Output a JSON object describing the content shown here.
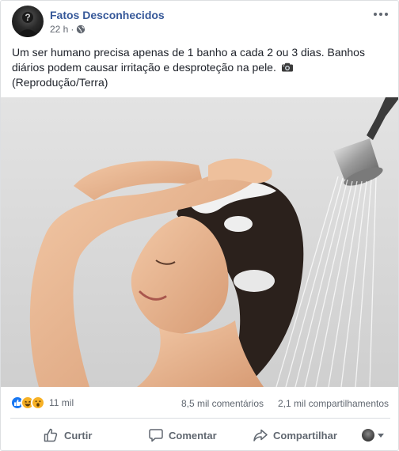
{
  "post": {
    "author": "Fatos Desconhecidos",
    "time": "22 h",
    "separator": "·",
    "text": "Um ser humano precisa apenas de 1 banho a cada 2 ou 3 dias. Banhos diários podem causar irritação e desproteção na pele.",
    "credit": "(Reprodução/Terra)",
    "photo_icon": "shower-woman-photo"
  },
  "stats": {
    "reaction_icons": [
      "like-icon",
      "haha-icon",
      "wow-icon"
    ],
    "reactions_count": "11 mil",
    "comments": "8,5 mil comentários",
    "shares": "2,1 mil compartilhamentos"
  },
  "actions": {
    "like": "Curtir",
    "comment": "Comentar",
    "share": "Compartilhar"
  },
  "colors": {
    "author_link": "#365899",
    "meta_text": "#616770",
    "like_blue": "#1877f2",
    "emoji_yellow": "#f7b125"
  }
}
